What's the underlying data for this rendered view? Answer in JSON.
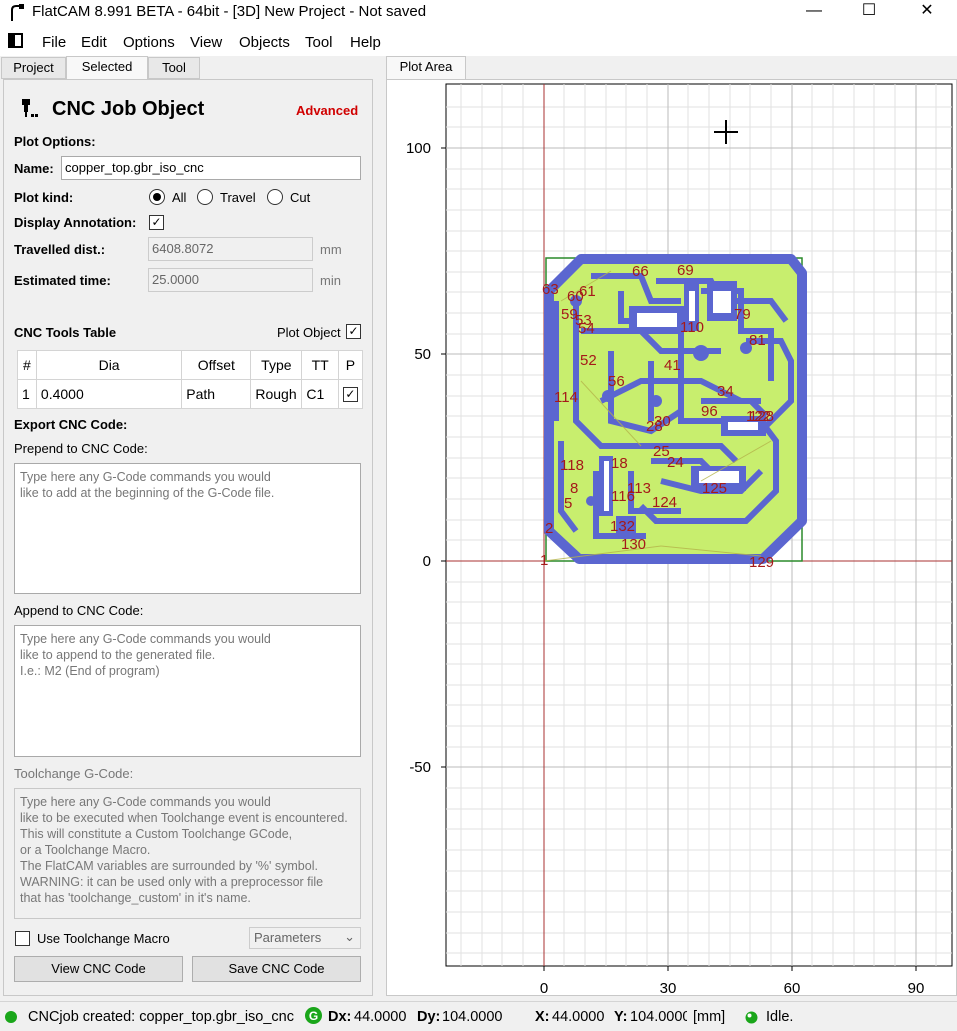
{
  "window": {
    "title": "FlatCAM 8.991 BETA - 64bit - [3D]    New Project - Not saved",
    "controls": [
      "minimize",
      "maximize",
      "close"
    ]
  },
  "menu": [
    "File",
    "Edit",
    "Options",
    "View",
    "Objects",
    "Tool",
    "Help"
  ],
  "left_tabs": [
    "Project",
    "Selected",
    "Tool"
  ],
  "right_tabs": [
    "Plot Area"
  ],
  "panel": {
    "title": "CNC Job Object",
    "advanced": "Advanced",
    "plot_options": "Plot Options:",
    "name_label": "Name:",
    "name_value": "copper_top.gbr_iso_cnc",
    "plot_kind_label": "Plot kind:",
    "plot_kind_options": [
      "All",
      "Travel",
      "Cut"
    ],
    "plot_kind_selected": "All",
    "display_annotation_label": "Display Annotation:",
    "display_annotation_checked": true,
    "travelled_label": "Travelled dist.:",
    "travelled_value": "6408.8072",
    "travelled_unit": "mm",
    "estimated_label": "Estimated time:",
    "estimated_value": "25.0000",
    "estimated_unit": "min",
    "tools_table_label": "CNC Tools Table",
    "plot_object_label": "Plot Object",
    "plot_object_checked": true,
    "table": {
      "headers": [
        "#",
        "Dia",
        "Offset",
        "Type",
        "TT",
        "P"
      ],
      "rows": [
        {
          "num": "1",
          "dia": "0.4000",
          "offset": "Path",
          "type": "Rough",
          "tt": "C1",
          "p": true
        }
      ]
    },
    "export_label": "Export CNC Code:",
    "prepend_label": "Prepend to CNC Code:",
    "prepend_placeholder": "Type here any G-Code commands you would\nlike to add at the beginning of the G-Code file.",
    "append_label": "Append to CNC Code:",
    "append_placeholder": "Type here any G-Code commands you would\nlike to append to the generated file.\nI.e.: M2 (End of program)",
    "toolchange_label": "Toolchange G-Code:",
    "toolchange_placeholder": "Type here any G-Code commands you would\nlike to be executed when Toolchange event is encountered.\nThis will constitute a Custom Toolchange GCode,\nor a Toolchange Macro.\nThe FlatCAM variables are surrounded by '%' symbol.\nWARNING: it can be used only with a preprocessor file\nthat has 'toolchange_custom' in it's name.",
    "use_macro_label": "Use Toolchange Macro",
    "use_macro_checked": false,
    "parameters_label": "Parameters",
    "view_button": "View CNC Code",
    "save_button": "Save CNC Code"
  },
  "plot": {
    "y_ticks": [
      "100",
      "50",
      "0",
      "-50"
    ],
    "x_ticks": [
      "0",
      "30",
      "60",
      "90"
    ],
    "pcb_colors": {
      "fill": "#c8ee6e",
      "trace": "#5b66d0",
      "label": "#a51a1a",
      "outline": "#2a8a2a",
      "axis": "#a83232"
    },
    "annotations": [
      "1",
      "2",
      "5",
      "8",
      "18",
      "24",
      "25",
      "28",
      "30",
      "34",
      "41",
      "52",
      "53",
      "54",
      "56",
      "59",
      "60",
      "61",
      "63",
      "66",
      "69",
      "79",
      "81",
      "96",
      "110",
      "113",
      "114",
      "116",
      "118",
      "122",
      "124",
      "125",
      "128",
      "129",
      "130",
      "132"
    ]
  },
  "status": {
    "message": "CNCjob created: copper_top.gbr_iso_cnc",
    "dx_label": "Dx:",
    "dx_value": "44.0000",
    "dy_label": "Dy:",
    "dy_value": "104.0000",
    "x_label": "X:",
    "x_value": "44.0000",
    "y_label": "Y:",
    "y_value": "104.0000",
    "units": "[mm]",
    "state": "Idle."
  }
}
